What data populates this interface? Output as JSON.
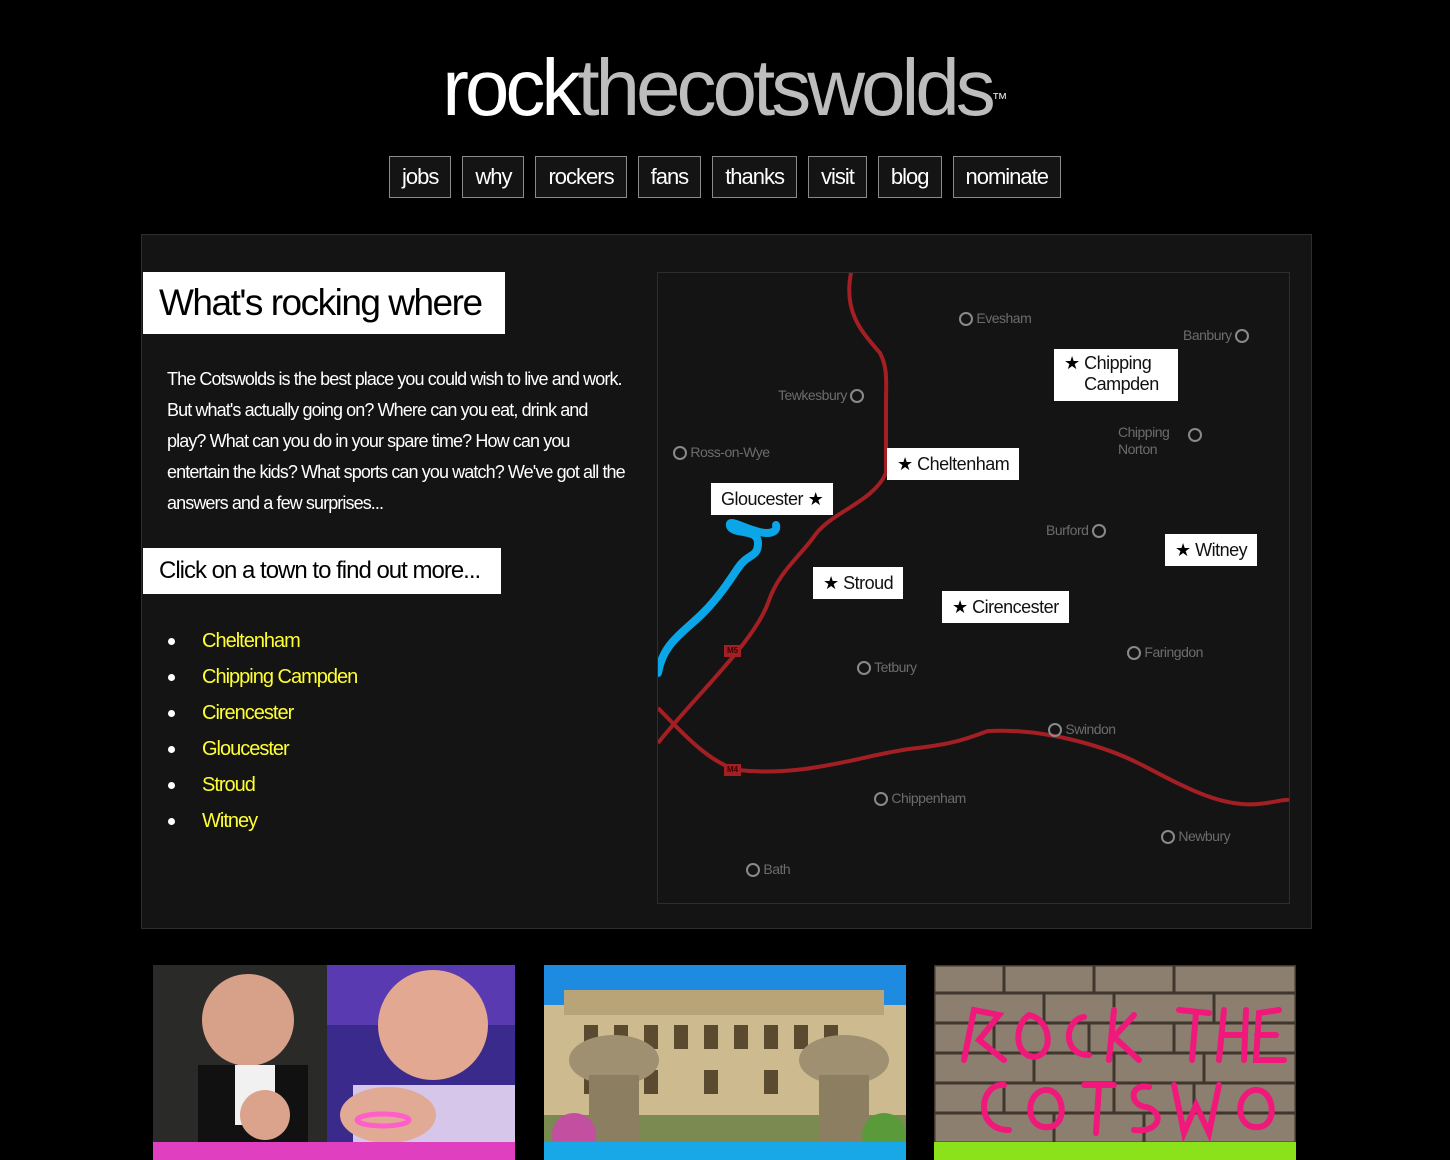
{
  "logo": {
    "part1": "rock",
    "part2": "thecotswolds",
    "tm": "™"
  },
  "nav": [
    "jobs",
    "why",
    "rockers",
    "fans",
    "thanks",
    "visit",
    "blog",
    "nominate"
  ],
  "heading": "What's rocking where",
  "intro": "The Cotswolds is the best place you could wish to live and work. But what's actually going on? Where can you eat, drink and play? What can you do in your spare time? How can you entertain the kids? What sports can you watch? We've got all the answers and a few surprises...",
  "cta": "Click on a town to find out more...",
  "towns": [
    "Cheltenham",
    "Chipping Campden",
    "Cirencester",
    "Gloucester",
    "Stroud",
    "Witney"
  ],
  "map": {
    "places": [
      "Evesham",
      "Banbury",
      "Tewkesbury",
      "Ross-on-Wye",
      "Chipping Norton",
      "Burford",
      "Faringdon",
      "Tetbury",
      "Swindon",
      "Chippenham",
      "Newbury",
      "Bath"
    ],
    "featured": [
      "Chipping Campden",
      "Cheltenham",
      "Gloucester",
      "Witney",
      "Stroud",
      "Cirencester"
    ],
    "roads": [
      "M5",
      "M4"
    ],
    "colors": {
      "road": "#a31f24",
      "river": "#0aa6e8"
    }
  },
  "cards": [
    {
      "image": "two-men-wristbands-photo",
      "accent": "#e040c0"
    },
    {
      "image": "cotswold-mansion-photo",
      "accent": "#18a8e8"
    },
    {
      "image": "stone-wall-graffiti-photo",
      "accent": "#8ce21a"
    }
  ]
}
